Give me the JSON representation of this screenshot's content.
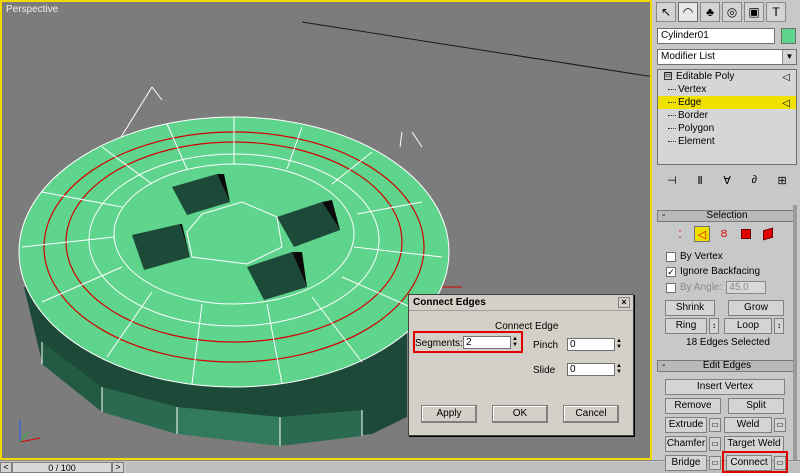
{
  "viewport": {
    "label": "Perspective"
  },
  "timeline": {
    "frame_text": "0 / 100",
    "left_arrow": "<",
    "right_arrow": ">"
  },
  "panel": {
    "tabs": [
      "create-tab",
      "modify-tab",
      "hierarchy-tab",
      "motion-tab",
      "display-tab",
      "utilities-tab"
    ],
    "object_name": "Cylinder01",
    "object_color": "#5fd48c",
    "modifier_list_label": "Modifier List",
    "stack": {
      "root": "Editable Poly",
      "root_box": "⊟",
      "items": [
        "Vertex",
        "Edge",
        "Border",
        "Polygon",
        "Element"
      ],
      "selected": "Edge"
    },
    "selection": {
      "title": "Selection",
      "by_vertex": "By Vertex",
      "ignore_backfacing": "Ignore Backfacing",
      "by_angle": "By Angle:",
      "angle_value": "45,0",
      "shrink": "Shrink",
      "grow": "Grow",
      "ring": "Ring",
      "loop": "Loop",
      "status": "18 Edges Selected"
    },
    "edit_edges": {
      "title": "Edit Edges",
      "insert_vertex": "Insert Vertex",
      "remove": "Remove",
      "split": "Split",
      "extrude": "Extrude",
      "weld": "Weld",
      "chamfer": "Chamfer",
      "target_weld": "Target Weld",
      "bridge": "Bridge",
      "connect": "Connect"
    }
  },
  "dialog": {
    "title": "Connect Edges",
    "close": "×",
    "group": "Connect Edge",
    "segments_label": "Segments:",
    "segments_value": "2",
    "pinch_label": "Pinch",
    "pinch_value": "0",
    "slide_label": "Slide",
    "slide_value": "0",
    "apply": "Apply",
    "ok": "OK",
    "cancel": "Cancel"
  },
  "colors": {
    "mesh": "#5fd48c",
    "selected_edge": "#d40000",
    "highlight": "#e00000",
    "active": "#f0e000"
  }
}
